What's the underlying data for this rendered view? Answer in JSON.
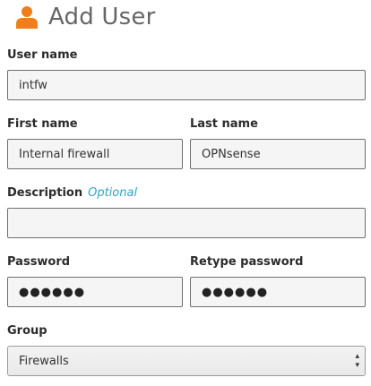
{
  "page": {
    "title": "Add User",
    "icon": "user-icon"
  },
  "form": {
    "username": {
      "label": "User name",
      "value": "intfw"
    },
    "first_name": {
      "label": "First name",
      "value": "Internal firewall"
    },
    "last_name": {
      "label": "Last name",
      "value": "OPNsense"
    },
    "description": {
      "label": "Description",
      "optional": "Optional",
      "value": ""
    },
    "password": {
      "label": "Password",
      "value": "●●●●●●"
    },
    "retype_password": {
      "label": "Retype password",
      "value": "●●●●●●"
    },
    "group": {
      "label": "Group",
      "value": "Firewalls"
    }
  },
  "colors": {
    "accent": "#e67e22",
    "optional": "#2aa6c8",
    "title": "#666666"
  }
}
